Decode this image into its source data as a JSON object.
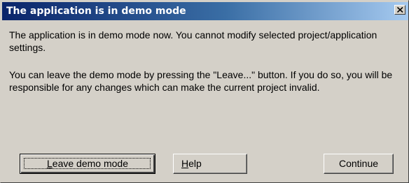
{
  "window": {
    "title": "The application is in demo mode",
    "close_icon": "close-x-icon"
  },
  "messages": {
    "line1": "The application is in demo mode now. You cannot modify selected project/application settings.",
    "line2": "You can leave the demo mode by pressing the \"Leave...\" button. If you do so, you will be responsible for any changes which can make the current project invalid."
  },
  "buttons": {
    "leave": {
      "mnemonic": "L",
      "rest": "eave demo mode"
    },
    "help": {
      "mnemonic": "H",
      "rest": "elp"
    },
    "continue": {
      "label": "Continue"
    }
  },
  "colors": {
    "face": "#d4d0c8",
    "title_start": "#0a246a",
    "title_end": "#a6caf0"
  }
}
